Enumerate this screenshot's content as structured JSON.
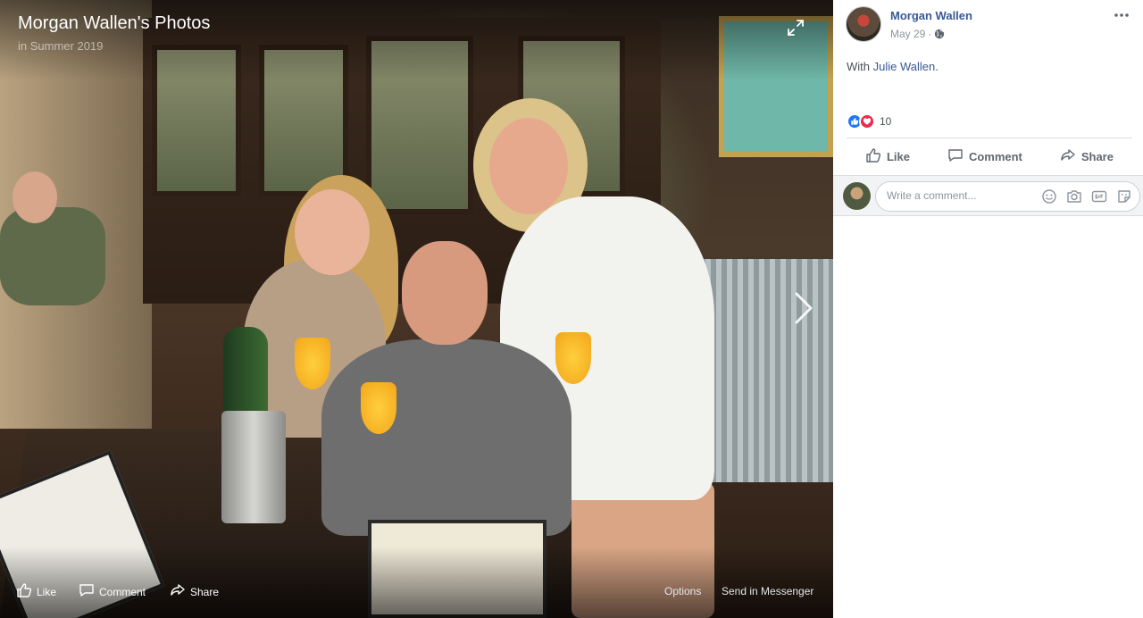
{
  "viewer": {
    "album_title": "Morgan Wallen's Photos",
    "album_subtitle": "in Summer 2019",
    "bottom_actions": {
      "like": "Like",
      "comment": "Comment",
      "share": "Share",
      "options": "Options",
      "send": "Send in Messenger"
    }
  },
  "post": {
    "author": "Morgan Wallen",
    "date": "May 29",
    "date_sep": "·",
    "with_prefix": "With ",
    "with_name": "Julie Wallen",
    "with_suffix": ".",
    "reaction_count": "10",
    "actions": {
      "like": "Like",
      "comment": "Comment",
      "share": "Share"
    },
    "comment_placeholder": "Write a comment..."
  },
  "colors": {
    "link": "#385898",
    "like_reaction": "#2078f4",
    "love_reaction": "#f0284a"
  }
}
